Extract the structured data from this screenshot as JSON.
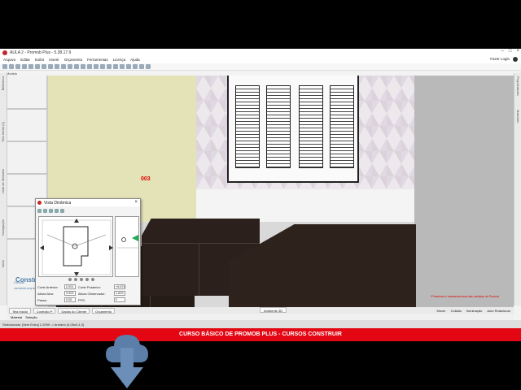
{
  "app": {
    "title": "AULA 2 - Promob Plus - 5.38.17.9",
    "menu": [
      "Arquivo",
      "Editar",
      "Exibir",
      "Inserir",
      "Orçamento",
      "Ferramentas",
      "Licença",
      "Ajuda"
    ],
    "login_label": "Fazer Login",
    "model_tab": "Modelo",
    "left_panel_labels": [
      "Biblioteca",
      "Tela Inicial (1)",
      "Lista de Módulos",
      "Navegação",
      "Inicio"
    ],
    "right_panel_labels": [
      "Propriedades",
      "Materiais"
    ]
  },
  "viewport": {
    "dimension_label": "003",
    "hint_text": "*Pressione e mantenha trava das medidas do Promob",
    "brand": {
      "small": "Cursos",
      "name": "Construir",
      "url": "construir.arq.br"
    }
  },
  "dynamic_view": {
    "title": "Vista Dinâmica",
    "fields": [
      {
        "label": "Corte Anterior:",
        "value": "0.001",
        "label2": "Corte Posterior:",
        "value2": "+6.674"
      },
      {
        "label": "Altura Alvo:",
        "value": "0.923",
        "label2": "Altura Observador:",
        "value2": "1.629"
      },
      {
        "label": "Passo:",
        "value": "0.05",
        "label2": "FPS:",
        "value2": "0"
      }
    ]
  },
  "bottom": {
    "tabs": [
      "Tela Inicial",
      "Conexão P",
      "Dados do Cliente",
      "Orçamento"
    ],
    "ambient_tab": "Ambiente 3D",
    "right_items": [
      "Mover",
      "Colisão",
      "Iluminação",
      "Auto Rotacionar"
    ],
    "sub_tabs": [
      "Material",
      "Seleção"
    ],
    "status": "Selecionado: [Item Extra] 1.2099 -> Armário (0,05x0,4,3)"
  },
  "banner": {
    "text": "CURSO BÁSICO DE PROMOB PLUS - CURSOS CONSTRUIR"
  }
}
